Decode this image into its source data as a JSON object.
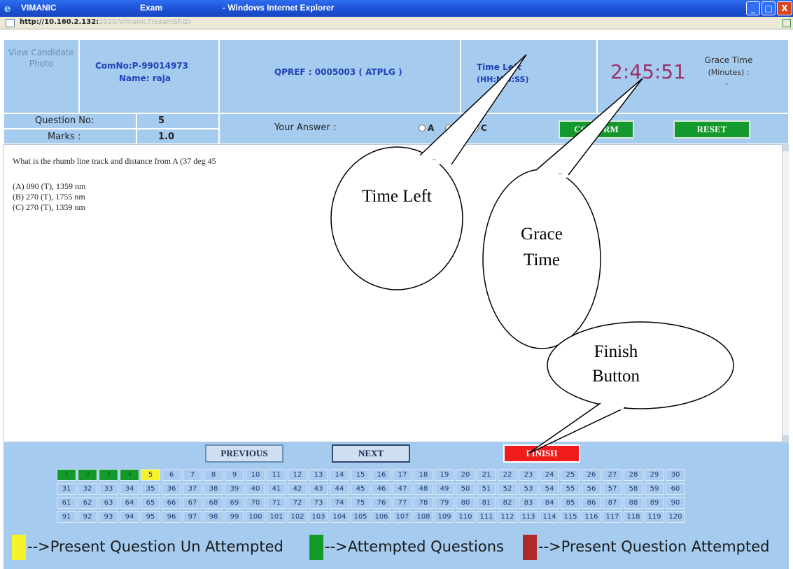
{
  "window": {
    "title_app": "VIMANIC",
    "title_section": "Exam",
    "title_browser": "- Windows Internet Explorer",
    "minimize_glyph": "_",
    "maximize_glyph": "□",
    "close_glyph": "X"
  },
  "address": {
    "host": "http://10.160.2.132:",
    "rest": "2020/Vimanic7/examSF.do"
  },
  "header": {
    "photo_link": "View Candidate Photo",
    "com_no": "ComNo:P-99014973",
    "name": "Name: raja",
    "qpref": "QPREF : 0005003 ( ATPLG )",
    "time_left_label": "Time Left",
    "time_left_format": "(HH:MM:SS)",
    "clock": "2:45:51",
    "grace_label": "Grace Time",
    "grace_unit": "(Minutes) :",
    "grace_value": "-"
  },
  "question_info": {
    "qno_label": "Question No:",
    "qno_value": "5",
    "marks_label": "Marks :",
    "marks_value": "1.0",
    "answer_label": "Your Answer :",
    "options": [
      "A",
      "B",
      "C"
    ],
    "confirm": "CONFIRM",
    "reset": "RESET"
  },
  "question": {
    "text": "What is the rhumb line track and distance from A (37 deg 45",
    "choices": [
      "(A)  090 (T), 1359 nm",
      "(B)  270 (T), 1755 nm",
      "(C)  270 (T), 1359 nm"
    ]
  },
  "nav": {
    "previous": "PREVIOUS",
    "next": "NEXT",
    "finish": "FINISH"
  },
  "grid": {
    "total": 120,
    "attempted": [
      1,
      2,
      3,
      4
    ],
    "current": 5
  },
  "legend": {
    "unattempted": "-->Present Question Un Attempted",
    "attempted": "-->Attempted Questions",
    "present_attempted": "-->Present Question Attempted",
    "colors": {
      "unattempted": "#f7f32a",
      "attempted": "#139a2a",
      "present_attempted": "#b02a2a"
    }
  },
  "callouts": {
    "time_left": "Time Left",
    "grace_time": "Grace Time",
    "finish_button": "Finish Button"
  }
}
